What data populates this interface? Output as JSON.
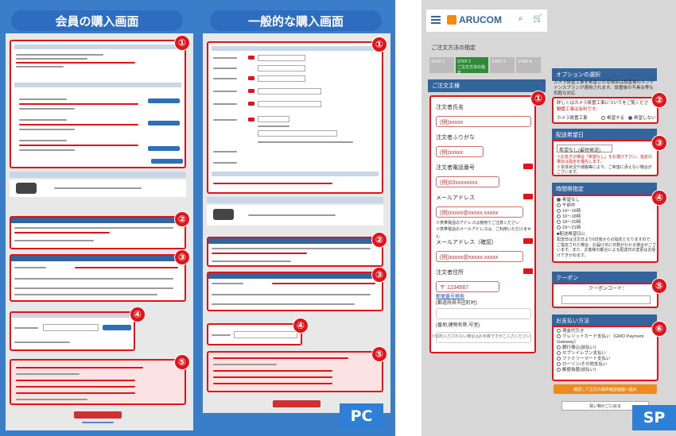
{
  "pc": {
    "member_title": "会員の購入画面",
    "general_title": "一般的な購入画面",
    "tag": "PC",
    "numbers": [
      "①",
      "②",
      "③",
      "④",
      "⑤"
    ]
  },
  "sp": {
    "logo": "ARUCOM",
    "tag": "SP",
    "step_header": "ご注文方法の指定",
    "steps": [
      {
        "label": "STEP 1"
      },
      {
        "label": "STEP 2",
        "sub": "ご注文方法の指定"
      },
      {
        "label": "STEP 3"
      },
      {
        "label": "STEP 4"
      }
    ],
    "order_section": "ご注文主様",
    "fields": [
      {
        "label": "注文者氏名",
        "value": "(例)xxxxx"
      },
      {
        "label": "注文者ふりがな",
        "value": "(例)xxxxx"
      },
      {
        "label": "注文者電話番号",
        "value": "(例)03xxxxxxxx"
      },
      {
        "label": "メールアドレス",
        "value": "(例)xxxxx@xxxxx.xxxxx",
        "note1": "※携帯電話のアドレスは使用でご注意ください",
        "note2": "※携帯電話のメールアドレスは、ご利用いただけません"
      },
      {
        "label": "メールアドレス（確認）",
        "value": "(例)xxxxx@xxxxx.xxxxx"
      },
      {
        "label": "注文者住所",
        "value": "〒 1234567",
        "link": "郵便番号検索",
        "sub": "(都道府県市区町村)"
      }
    ],
    "address_label": "(番地,建物名称,号室)",
    "address_note": "※住所入力されない場合はお手数ですがご入力ください",
    "option_header": "オプションの選択",
    "option_text": "カメラ設置工事を希望される場合は設置後のメンテナンスプランが適用されます。設置後の不具合等も気軽な対応",
    "option_link_text": "詳しくはカメラ設置工事についてをご覧ください。",
    "option_link_red": "設置工事は有料です。",
    "option_label": "カメラ設置工事",
    "option_choices": [
      "希望する",
      "希望しない"
    ],
    "delivery_header": "配送希望日",
    "delivery_select": "希望なし(最短発送)",
    "delivery_notes": [
      "※お急ぎの場合「希望なし」をお選び下さい。指定の場合は指定を優先します。",
      "※本体状況や運搬等により、ご希望に添えない場合がございます。"
    ],
    "time_header": "時間帯指定",
    "time_options": [
      "希望なし",
      "午前中",
      "14〜16時",
      "16〜18時",
      "18〜20時",
      "19〜21時"
    ],
    "time_note_head": "■配送希望日に",
    "time_note": "配送日は注文日より6日後からの指定となりますので、ご指定された場合、お届け日に日数がかかる場合がございます。また、お客様の都合による配送日の変更はお受けできかねます。",
    "coupon_header": "クーポン",
    "coupon_label": "クーポンコード：",
    "payment_header": "お支払い方法",
    "payment_options": [
      "現金代引き",
      "クレジットカード支払い（GMO Payment Gateway）",
      "銀行振込(前払い)",
      "セブンイレブン支払い",
      "ファミリーマート支払い",
      "ローソン/その他支払い",
      "郵便為替(前払い)"
    ],
    "next_button": "確認して注文の最終確認画面へ進め",
    "back_button": "買い物かごに戻る",
    "numbers": [
      "①",
      "②",
      "③",
      "④",
      "⑤",
      "⑥"
    ]
  },
  "colors": {
    "accent_red": "#e0151b",
    "pc_blue": "#3a7dc9",
    "header_blue": "#34649c"
  }
}
